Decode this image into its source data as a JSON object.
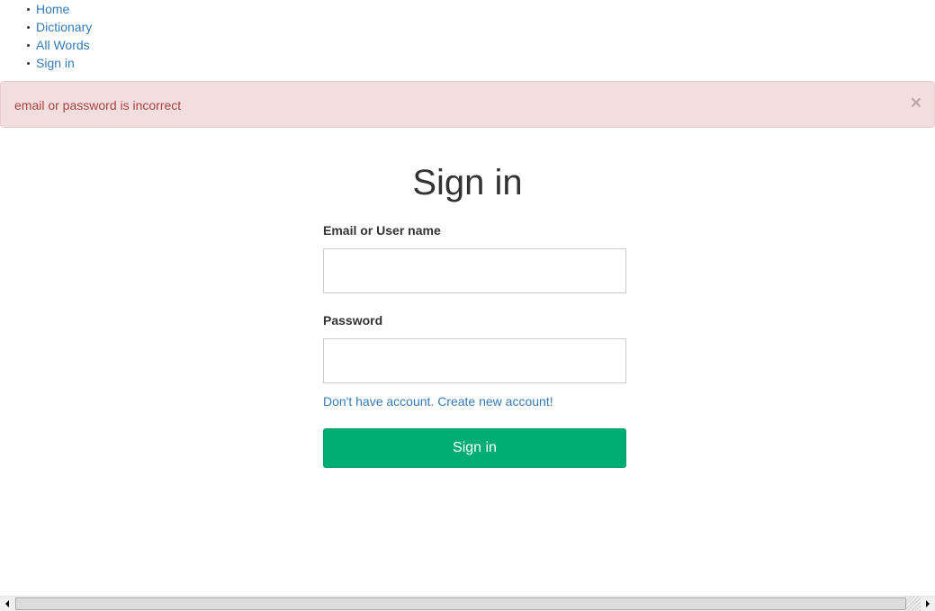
{
  "nav": {
    "items": [
      {
        "label": "Home"
      },
      {
        "label": "Dictionary"
      },
      {
        "label": "All Words"
      },
      {
        "label": "Sign in"
      }
    ]
  },
  "alert": {
    "message": "email or password is incorrect",
    "close_icon": "close-icon",
    "close_glyph": "×",
    "color": "#a94442",
    "background": "#f2dede"
  },
  "form": {
    "title": "Sign in",
    "email_label": "Email or User name",
    "email_value": "",
    "email_placeholder": "",
    "password_label": "Password",
    "password_value": "",
    "password_placeholder": "",
    "create_account_link": "Don't have account. Create new account!",
    "submit_label": "Sign in",
    "submit_color": "#00ad73",
    "link_color": "#337ab7"
  },
  "scrollbar": {
    "left_arrow_icon": "scroll-left-arrow-icon",
    "right_arrow_icon": "scroll-right-arrow-icon"
  }
}
